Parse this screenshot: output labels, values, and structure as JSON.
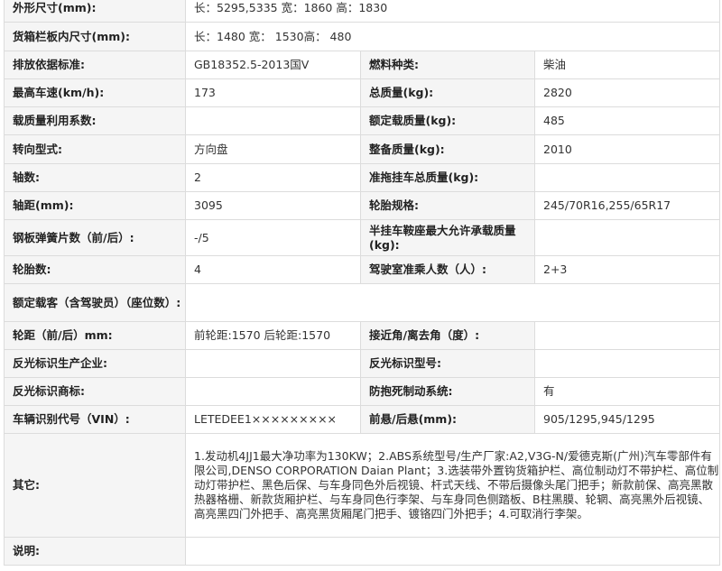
{
  "rows": {
    "dimensions": {
      "label": "外形尺寸(mm):",
      "value": "长：5295,5335 宽：1860 高：1830"
    },
    "cargo_box": {
      "label": "货箱栏板内尺寸(mm):",
      "value": "长：1480 宽：  1530高：  480"
    },
    "emission": {
      "label": "排放依据标准:",
      "value": "GB18352.5-2013国Ⅴ",
      "label2": "燃料种类:",
      "value2": "柴油"
    },
    "max_speed": {
      "label": "最高车速(km/h):",
      "value": "173",
      "label2": "总质量(kg):",
      "value2": "2820"
    },
    "load_util": {
      "label": "载质量利用系数:",
      "value": "",
      "label2": "额定载质量(kg):",
      "value2": "485"
    },
    "steering": {
      "label": "转向型式:",
      "value": "方向盘",
      "label2": "整备质量(kg):",
      "value2": "2010"
    },
    "axles": {
      "label": "轴数:",
      "value": "2",
      "label2": "准拖挂车总质量(kg):",
      "value2": ""
    },
    "wheelbase": {
      "label": "轴距(mm):",
      "value": "3095",
      "label2": "轮胎规格:",
      "value2": "245/70R16,255/65R17"
    },
    "springs": {
      "label": "钢板弹簧片数（前/后）:",
      "value": "-/5",
      "label2": "半挂车鞍座最大允许承载质量(kg):",
      "value2": ""
    },
    "tires": {
      "label": "轮胎数:",
      "value": "4",
      "label2": "驾驶室准乘人数（人）:",
      "value2": "2+3"
    },
    "rated_passengers": {
      "label": "额定载客（含驾驶员）（座位数）:",
      "value": ""
    },
    "track": {
      "label": "轮距（前/后）mm:",
      "value": "前轮距:1570 后轮距:1570",
      "label2": "接近角/离去角（度）:",
      "value2": ""
    },
    "reflector_maker": {
      "label": "反光标识生产企业:",
      "value": "",
      "label2": "反光标识型号:",
      "value2": ""
    },
    "reflector_brand": {
      "label": "反光标识商标:",
      "value": "",
      "label2": "防抱死制动系统:",
      "value2": "有"
    },
    "vin": {
      "label": "车辆识别代号（VIN）:",
      "value": "LETEDEE1×××××××××",
      "label2": "前悬/后悬(mm):",
      "value2": "905/1295,945/1295"
    },
    "other": {
      "label": "其它:",
      "value": "1.发动机4JJ1最大净功率为130KW；2.ABS系统型号/生产厂家:A2,V3G-N/爱德克斯(广州)汽车零部件有限公司,DENSO CORPORATION Daian Plant；3.选装带外置钩货箱护栏、高位制动灯不带护栏、高位制动灯带护栏、黑色后保、与车身同色外后视镜、杆式天线、不带后摄像头尾门把手；新款前保、高亮黑散热器格栅、新款货厢护栏、与车身同色行李架、与车身同色侧踏板、B柱黑膜、轮辋、高亮黑外后视镜、高亮黑四门外把手、高亮黑货厢尾门把手、镀铬四门外把手；4.可取消行李架。"
    },
    "notes": {
      "label": "说明:",
      "value": ""
    }
  },
  "colors": {
    "label_bg": "#f5f5f5",
    "border": "#dcdcdc",
    "text": "#333333"
  }
}
